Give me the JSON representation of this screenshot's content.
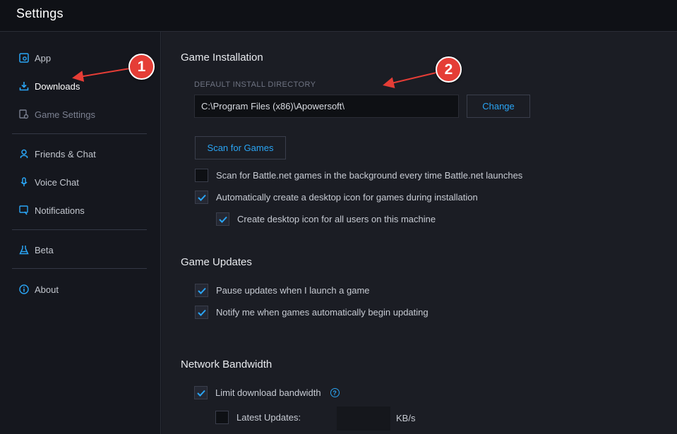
{
  "window": {
    "title": "Settings"
  },
  "sidebar": {
    "items": [
      {
        "label": "App",
        "icon": "app-settings-icon"
      },
      {
        "label": "Downloads",
        "icon": "download-icon"
      },
      {
        "label": "Game Settings",
        "icon": "game-settings-icon"
      },
      {
        "label": "Friends & Chat",
        "icon": "person-icon"
      },
      {
        "label": "Voice Chat",
        "icon": "microphone-icon"
      },
      {
        "label": "Notifications",
        "icon": "notification-icon"
      },
      {
        "label": "Beta",
        "icon": "beta-flask-icon"
      },
      {
        "label": "About",
        "icon": "info-icon"
      }
    ],
    "active": "Downloads"
  },
  "game_installation": {
    "title": "Game Installation",
    "directory_label": "DEFAULT INSTALL DIRECTORY",
    "directory_value": "C:\\Program Files (x86)\\Apowersoft\\",
    "change_label": "Change",
    "scan_label": "Scan for Games",
    "options": [
      {
        "label": "Scan for Battle.net games in the background every time Battle.net launches",
        "checked": false
      },
      {
        "label": "Automatically create a desktop icon for games during installation",
        "checked": true
      },
      {
        "label": "Create desktop icon for all users on this machine",
        "checked": true
      }
    ]
  },
  "game_updates": {
    "title": "Game Updates",
    "options": [
      {
        "label": "Pause updates when I launch a game",
        "checked": true
      },
      {
        "label": "Notify me when games automatically begin updating",
        "checked": true
      }
    ]
  },
  "network_bandwidth": {
    "title": "Network Bandwidth",
    "limit_label": "Limit download bandwidth",
    "limit_checked": true,
    "latest_updates_label": "Latest Updates:",
    "latest_updates_checked": false,
    "latest_updates_value": "",
    "unit": "KB/s"
  },
  "annotations": [
    {
      "number": "1"
    },
    {
      "number": "2"
    }
  ],
  "colors": {
    "accent": "#2aa5f5",
    "callout": "#e53d36",
    "arrow": "#e53d36"
  }
}
